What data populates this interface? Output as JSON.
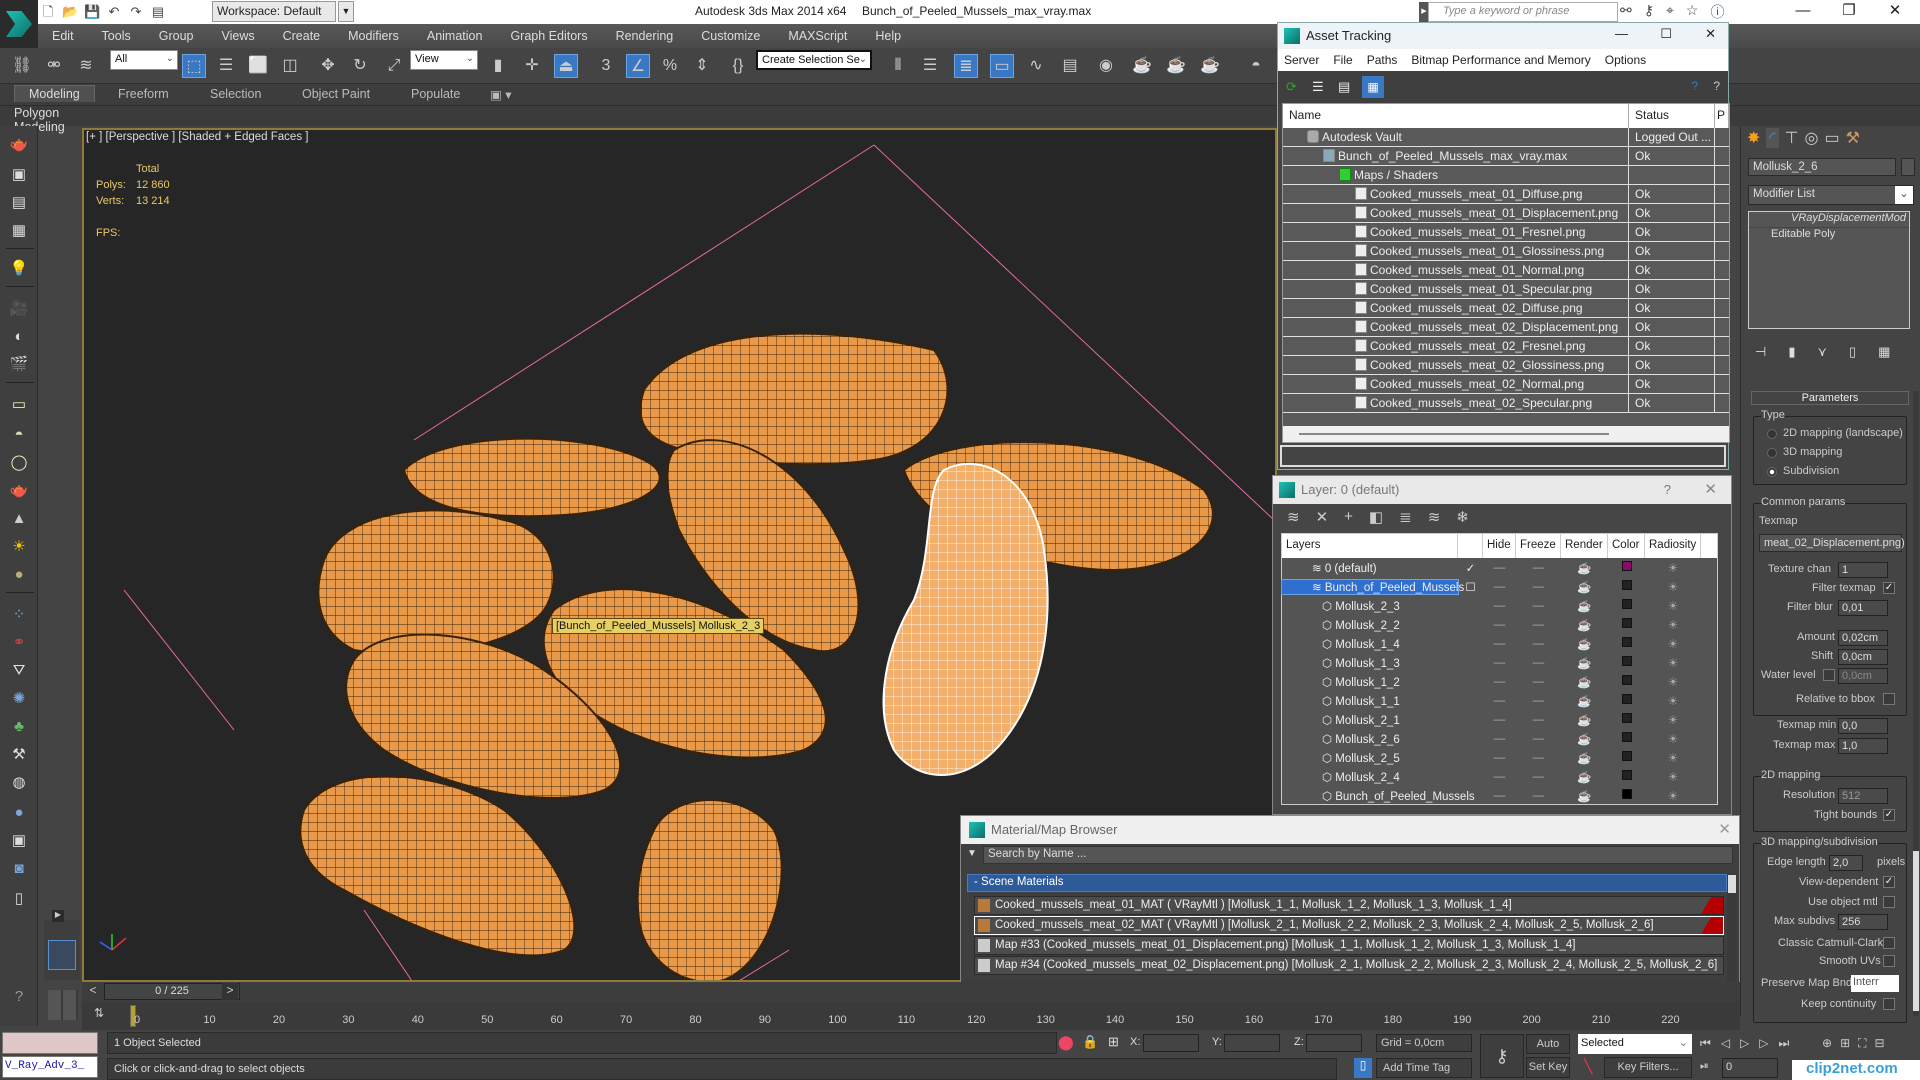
{
  "app": {
    "title": "Autodesk 3ds Max  2014 x64",
    "file": "Bunch_of_Peeled_Mussels_max_vray.max",
    "workspace": "Workspace: Default",
    "search_placeholder": "Type a keyword or phrase"
  },
  "menu": [
    "Edit",
    "Tools",
    "Group",
    "Views",
    "Create",
    "Modifiers",
    "Animation",
    "Graph Editors",
    "Rendering",
    "Customize",
    "MAXScript",
    "Help"
  ],
  "toolbar": {
    "selection_filter": "All",
    "ref_coord": "View",
    "snap_value": "3",
    "named_selection": "Create Selection Se"
  },
  "ribbon": {
    "tabs": [
      "Modeling",
      "Freeform",
      "Selection",
      "Object Paint",
      "Populate"
    ],
    "active": "Modeling",
    "sub": "Polygon Modeling"
  },
  "viewport": {
    "label": "[+ ] [Perspective ] [Shaded + Edged Faces ]",
    "stats_header": "Total",
    "polys_label": "Polys:",
    "polys": "12 860",
    "verts_label": "Verts:",
    "verts": "13 214",
    "fps_label": "FPS:",
    "tooltip": "[Bunch_of_Peeled_Mussels] Mollusk_2_3"
  },
  "asset_tracking": {
    "title": "Asset Tracking",
    "menu": [
      "Server",
      "File",
      "Paths",
      "Bitmap Performance and Memory",
      "Options"
    ],
    "columns": [
      "Name",
      "Status",
      "P"
    ],
    "rows": [
      {
        "name": "Autodesk Vault",
        "status": "Logged Out ...",
        "level": 1,
        "icon": "vault-icon"
      },
      {
        "name": "Bunch_of_Peeled_Mussels_max_vray.max",
        "status": "Ok",
        "level": 2,
        "icon": "max-file-icon"
      },
      {
        "name": "Maps / Shaders",
        "status": "",
        "level": 3,
        "icon": "maps-icon"
      },
      {
        "name": "Cooked_mussels_meat_01_Diffuse.png",
        "status": "Ok",
        "level": 4,
        "icon": "image-file-icon"
      },
      {
        "name": "Cooked_mussels_meat_01_Displacement.png",
        "status": "Ok",
        "level": 4,
        "icon": "image-file-icon"
      },
      {
        "name": "Cooked_mussels_meat_01_Fresnel.png",
        "status": "Ok",
        "level": 4,
        "icon": "image-file-icon"
      },
      {
        "name": "Cooked_mussels_meat_01_Glossiness.png",
        "status": "Ok",
        "level": 4,
        "icon": "image-file-icon"
      },
      {
        "name": "Cooked_mussels_meat_01_Normal.png",
        "status": "Ok",
        "level": 4,
        "icon": "image-file-icon"
      },
      {
        "name": "Cooked_mussels_meat_01_Specular.png",
        "status": "Ok",
        "level": 4,
        "icon": "image-file-icon"
      },
      {
        "name": "Cooked_mussels_meat_02_Diffuse.png",
        "status": "Ok",
        "level": 4,
        "icon": "image-file-icon"
      },
      {
        "name": "Cooked_mussels_meat_02_Displacement.png",
        "status": "Ok",
        "level": 4,
        "icon": "image-file-icon"
      },
      {
        "name": "Cooked_mussels_meat_02_Fresnel.png",
        "status": "Ok",
        "level": 4,
        "icon": "image-file-icon"
      },
      {
        "name": "Cooked_mussels_meat_02_Glossiness.png",
        "status": "Ok",
        "level": 4,
        "icon": "image-file-icon"
      },
      {
        "name": "Cooked_mussels_meat_02_Normal.png",
        "status": "Ok",
        "level": 4,
        "icon": "image-file-icon"
      },
      {
        "name": "Cooked_mussels_meat_02_Specular.png",
        "status": "Ok",
        "level": 4,
        "icon": "image-file-icon"
      }
    ],
    "path_field": ""
  },
  "layer_manager": {
    "title": "Layer: 0 (default)",
    "help": "?",
    "columns": [
      "Layers",
      "",
      "Hide",
      "Freeze",
      "Render",
      "Color",
      "Radiosity"
    ],
    "rows": [
      {
        "name": "0 (default)",
        "type": "layer",
        "check": "✓",
        "color": "#8b0a6e",
        "selected": false
      },
      {
        "name": "Bunch_of_Peeled_Mussels",
        "type": "layer",
        "check": "☐",
        "color": "#222222",
        "selected": true
      },
      {
        "name": "Mollusk_2_3",
        "type": "object",
        "check": "",
        "color": "#222222",
        "selected": false
      },
      {
        "name": "Mollusk_2_2",
        "type": "object",
        "check": "",
        "color": "#222222",
        "selected": false
      },
      {
        "name": "Mollusk_1_4",
        "type": "object",
        "check": "",
        "color": "#222222",
        "selected": false
      },
      {
        "name": "Mollusk_1_3",
        "type": "object",
        "check": "",
        "color": "#222222",
        "selected": false
      },
      {
        "name": "Mollusk_1_2",
        "type": "object",
        "check": "",
        "color": "#222222",
        "selected": false
      },
      {
        "name": "Mollusk_1_1",
        "type": "object",
        "check": "",
        "color": "#222222",
        "selected": false
      },
      {
        "name": "Mollusk_2_1",
        "type": "object",
        "check": "",
        "color": "#222222",
        "selected": false
      },
      {
        "name": "Mollusk_2_6",
        "type": "object",
        "check": "",
        "color": "#222222",
        "selected": false
      },
      {
        "name": "Mollusk_2_5",
        "type": "object",
        "check": "",
        "color": "#222222",
        "selected": false
      },
      {
        "name": "Mollusk_2_4",
        "type": "object",
        "check": "",
        "color": "#222222",
        "selected": false
      },
      {
        "name": "Bunch_of_Peeled_Mussels",
        "type": "object",
        "check": "",
        "color": "#000000",
        "selected": false
      }
    ]
  },
  "material_browser": {
    "title": "Material/Map Browser",
    "search_placeholder": "Search by Name ...",
    "section": "- Scene Materials",
    "items": [
      {
        "label": "Cooked_mussels_meat_01_MAT ( VRayMtl ) [Mollusk_1_1, Mollusk_1_2, Mollusk_1_3, Mollusk_1_4]",
        "kind": "material",
        "selected": false
      },
      {
        "label": "Cooked_mussels_meat_02_MAT ( VRayMtl ) [Mollusk_2_1, Mollusk_2_2, Mollusk_2_3, Mollusk_2_4, Mollusk_2_5, Mollusk_2_6]",
        "kind": "material",
        "selected": true
      },
      {
        "label": "Map #33 (Cooked_mussels_meat_01_Displacement.png) [Mollusk_1_1, Mollusk_1_2, Mollusk_1_3, Mollusk_1_4]",
        "kind": "map",
        "selected": false
      },
      {
        "label": "Map #34 (Cooked_mussels_meat_02_Displacement.png) [Mollusk_2_1, Mollusk_2_2, Mollusk_2_3, Mollusk_2_4, Mollusk_2_5, Mollusk_2_6]",
        "kind": "map",
        "selected": false
      }
    ]
  },
  "command_panel": {
    "object_name": "Mollusk_2_6",
    "modifier_list": "Modifier List",
    "stack": [
      "VRayDisplacementMod",
      "Editable Poly"
    ],
    "rollout": "Parameters",
    "type_group": "Type",
    "type_options": [
      "2D mapping (landscape)",
      "3D mapping",
      "Subdivision"
    ],
    "type_selected": 2,
    "common_group": "Common params",
    "texmap_label": "Texmap",
    "texmap": "meat_02_Displacement.png)",
    "texture_chan_label": "Texture chan",
    "texture_chan": "1",
    "filter_texmap_label": "Filter texmap",
    "filter_texmap": true,
    "filter_blur_label": "Filter blur",
    "filter_blur": "0,01",
    "amount_label": "Amount",
    "amount": "0,02cm",
    "shift_label": "Shift",
    "shift": "0,0cm",
    "water_level_label": "Water level",
    "water_level": "0,0cm",
    "relative_bbox_label": "Relative to bbox",
    "texmap_min_label": "Texmap min",
    "texmap_min": "0,0",
    "texmap_max_label": "Texmap max",
    "texmap_max": "1,0",
    "map2d_group": "2D mapping",
    "resolution_label": "Resolution",
    "resolution": "512",
    "tight_bounds_label": "Tight bounds",
    "map3d_group": "3D mapping/subdivision",
    "edge_length_label": "Edge length",
    "edge_length": "2,0",
    "pixels_label": "pixels",
    "view_dependent_label": "View-dependent",
    "use_object_mtl_label": "Use object mtl",
    "max_subdivs_label": "Max subdivs",
    "max_subdivs": "256",
    "catmull_label": "Classic Catmull-Clark",
    "smooth_uvs_label": "Smooth UVs",
    "preserve_label": "Preserve Map Bnd",
    "preserve_value": "Interr",
    "keep_continuity_label": "Keep continuity"
  },
  "timeline": {
    "frame": "0 / 225",
    "ticks": [
      "0",
      "10",
      "20",
      "30",
      "40",
      "50",
      "60",
      "70",
      "80",
      "90",
      "100",
      "110",
      "120",
      "130",
      "140",
      "150",
      "160",
      "170",
      "180",
      "190",
      "200",
      "210",
      "220"
    ]
  },
  "status": {
    "selection": "1 Object Selected",
    "prompt": "Click or click-and-drag to select objects",
    "maxscript": "V_Ray_Adv_3_",
    "x_label": "X:",
    "y_label": "Y:",
    "z_label": "Z:",
    "grid": "Grid = 0,0cm",
    "add_time_tag": "Add Time Tag",
    "auto_key": "Auto Key",
    "set_key": "Set Key",
    "key_mode": "Selected",
    "key_filters": "Key Filters...",
    "current_frame": "0"
  },
  "watermark": "clip2net.com"
}
